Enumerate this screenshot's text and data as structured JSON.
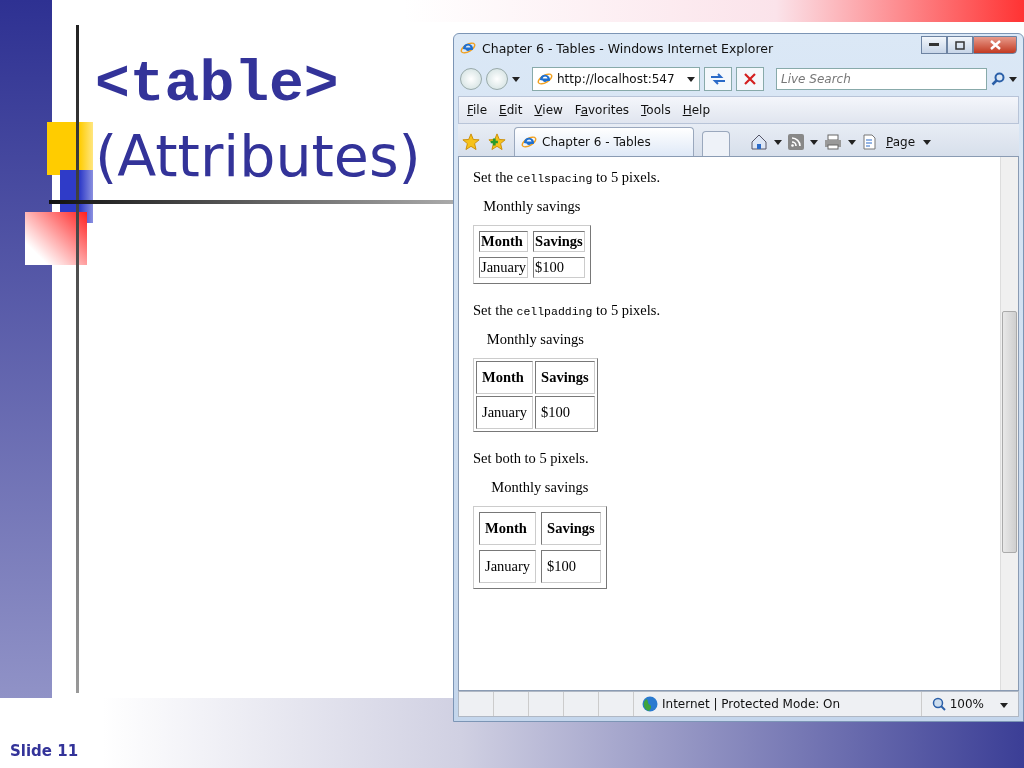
{
  "slide": {
    "title_code": "<table>",
    "title_text": "(Attributes)",
    "footer": "Slide 11"
  },
  "browser": {
    "title": "Chapter 6 - Tables - Windows Internet Explorer",
    "address": "http://localhost:547",
    "search": {
      "placeholder": "Live Search"
    },
    "menu": [
      {
        "key": "F",
        "post": "ile"
      },
      {
        "key": "E",
        "post": "dit"
      },
      {
        "key": "V",
        "post": "iew"
      },
      {
        "pre": "F",
        "key": "a",
        "post": "vorites"
      },
      {
        "key": "T",
        "post": "ools"
      },
      {
        "key": "H",
        "post": "elp"
      }
    ],
    "tabs": [
      {
        "label": "Chapter 6 - Tables",
        "selected": true
      }
    ],
    "page_menu": {
      "key": "P",
      "post": "age"
    },
    "sections": [
      {
        "kind": "spacing",
        "intro": [
          {
            "text": "Set the "
          },
          {
            "text": "cellspacing",
            "code": true
          },
          {
            "text": " to 5 pixels."
          }
        ],
        "caption": "Monthly savings",
        "columns": [
          "Month",
          "Savings"
        ],
        "rows": [
          [
            "January",
            "$100"
          ]
        ]
      },
      {
        "kind": "padding",
        "intro": [
          {
            "text": "Set the "
          },
          {
            "text": "cellpadding",
            "code": true
          },
          {
            "text": " to 5 pixels."
          }
        ],
        "caption": "Monthly savings",
        "columns": [
          "Month",
          "Savings"
        ],
        "rows": [
          [
            "January",
            "$100"
          ]
        ]
      },
      {
        "kind": "both",
        "intro": [
          {
            "text": "Set both to 5 pixels."
          }
        ],
        "caption": "Monthly savings",
        "columns": [
          "Month",
          "Savings"
        ],
        "rows": [
          [
            "January",
            "$100"
          ]
        ]
      }
    ],
    "status_bar": {
      "zone": "Internet | Protected Mode: On",
      "zoom": "100%"
    }
  }
}
